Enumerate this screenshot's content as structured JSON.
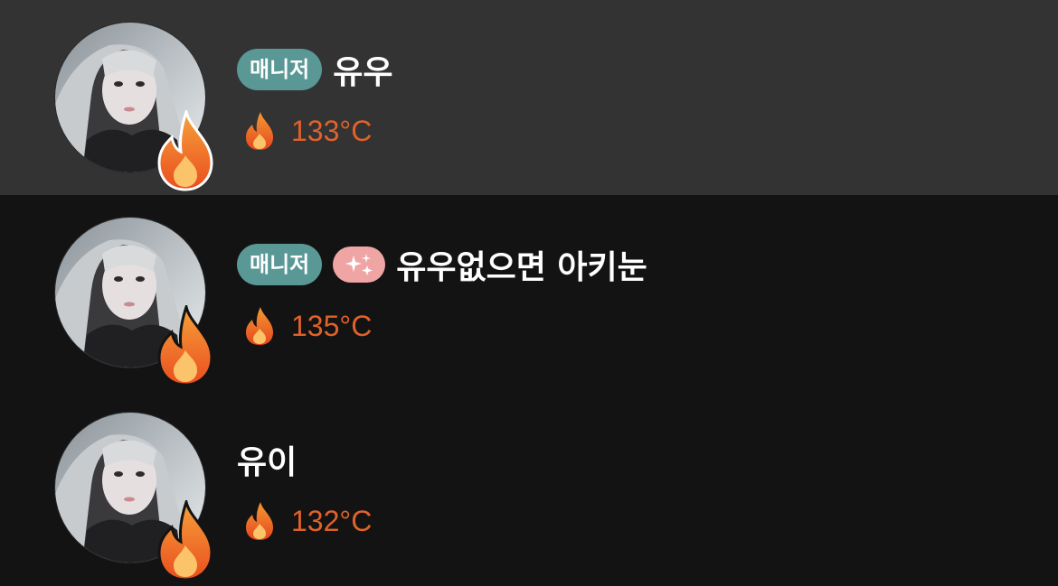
{
  "members": [
    {
      "badges": {
        "manager": "매니저",
        "sparkle": false
      },
      "nickname": "유우",
      "temperature": "133°C",
      "highlighted": true
    },
    {
      "badges": {
        "manager": "매니저",
        "sparkle": true
      },
      "nickname": "유우없으면 아키눈",
      "temperature": "135°C",
      "highlighted": false
    },
    {
      "badges": {
        "manager": "",
        "sparkle": false
      },
      "nickname": "유이",
      "temperature": "132°C",
      "highlighted": false
    }
  ],
  "icons": {
    "temperature": "fire-icon",
    "avatar_badge": "fire-icon",
    "sparkle": "sparkles-icon"
  },
  "colors": {
    "highlight_row": "#333334",
    "background": "#131313",
    "manager_badge": "#5a9896",
    "sparkle_badge": "#f0a5a5",
    "temperature_text": "#e0622a"
  }
}
